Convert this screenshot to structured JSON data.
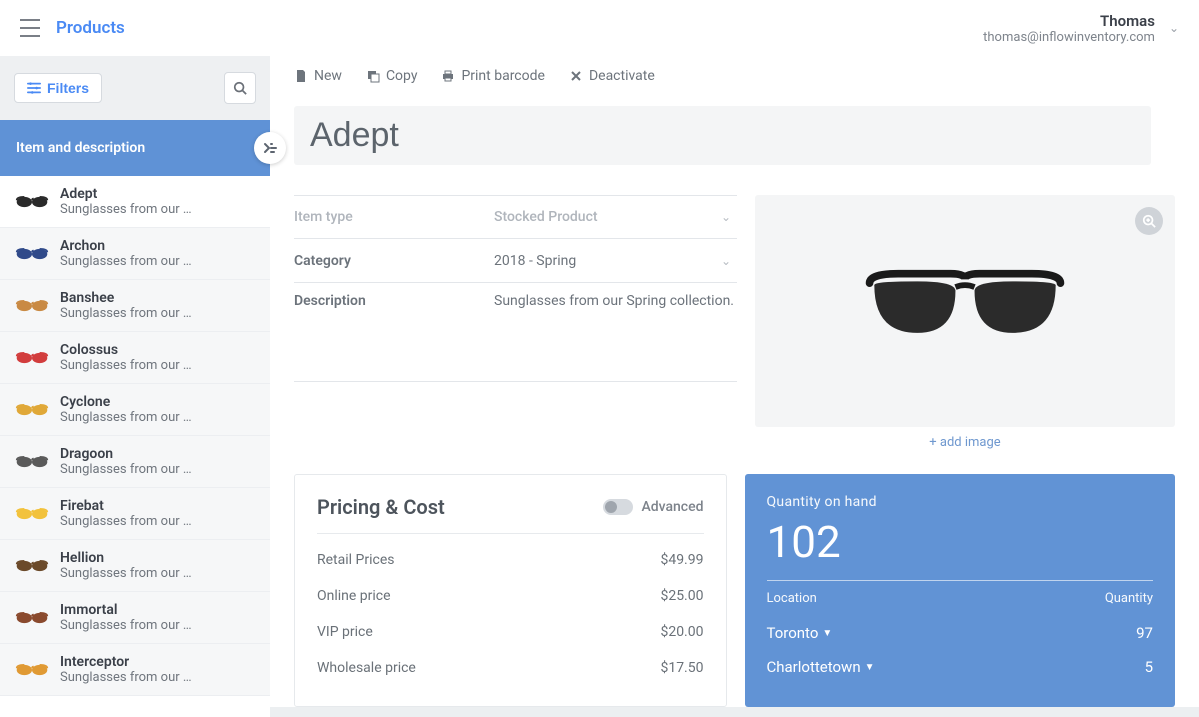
{
  "header": {
    "brand": "Products",
    "user_name": "Thomas",
    "user_email": "thomas@inflowinventory.com"
  },
  "sidebar": {
    "filters_label": "Filters",
    "list_header": "Item and description",
    "desc_trunc": "Sunglasses from our …",
    "items": [
      {
        "name": "Adept",
        "color": "#2a2a2a"
      },
      {
        "name": "Archon",
        "color": "#304a8a"
      },
      {
        "name": "Banshee",
        "color": "#c98a44"
      },
      {
        "name": "Colossus",
        "color": "#d23d3d"
      },
      {
        "name": "Cyclone",
        "color": "#e0a838"
      },
      {
        "name": "Dragoon",
        "color": "#5a5a5a"
      },
      {
        "name": "Firebat",
        "color": "#f2c23c"
      },
      {
        "name": "Hellion",
        "color": "#6b4a2a"
      },
      {
        "name": "Immortal",
        "color": "#8a4a2e"
      },
      {
        "name": "Interceptor",
        "color": "#e09a34"
      }
    ]
  },
  "toolbar": {
    "new": "New",
    "copy": "Copy",
    "print": "Print barcode",
    "deactivate": "Deactivate"
  },
  "product": {
    "title": "Adept",
    "item_type_label": "Item type",
    "item_type_value": "Stocked Product",
    "category_label": "Category",
    "category_value": "2018 - Spring",
    "description_label": "Description",
    "description_value": "Sunglasses from our Spring collection.",
    "add_image": "+ add image"
  },
  "pricing": {
    "heading": "Pricing & Cost",
    "advanced": "Advanced",
    "rows": [
      {
        "label": "Retail Prices",
        "value": "$49.99"
      },
      {
        "label": "Online price",
        "value": "$25.00"
      },
      {
        "label": "VIP price",
        "value": "$20.00"
      },
      {
        "label": "Wholesale price",
        "value": "$17.50"
      }
    ]
  },
  "stock": {
    "heading": "Quantity on hand",
    "total": "102",
    "col_location": "Location",
    "col_quantity": "Quantity",
    "rows": [
      {
        "loc": "Toronto",
        "qty": "97"
      },
      {
        "loc": "Charlottetown",
        "qty": "5"
      }
    ]
  }
}
